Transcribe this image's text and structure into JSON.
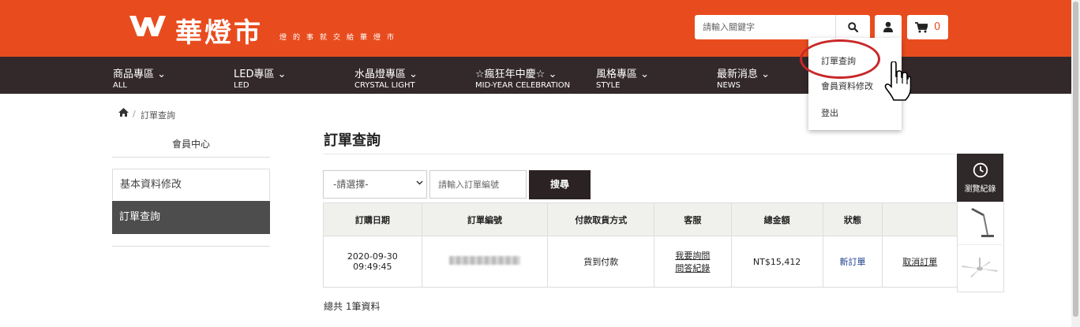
{
  "header": {
    "brand_name": "華燈市",
    "tagline": "燈的事就交給華燈市",
    "search": {
      "placeholder": "請輸入關鍵字"
    },
    "cart_count": "0",
    "colors": {
      "primary": "#e84c1e",
      "nav_bg": "#33292a"
    }
  },
  "nav": {
    "items": [
      {
        "label": "商品專區",
        "sub": "ALL"
      },
      {
        "label": "LED專區",
        "sub": "LED"
      },
      {
        "label": "水晶燈專區",
        "sub": "CRYSTAL LIGHT"
      },
      {
        "label": "☆瘋狂年中慶☆",
        "sub": "MID-YEAR CELEBRATION"
      },
      {
        "label": "風格專區",
        "sub": "STYLE"
      },
      {
        "label": "最新消息",
        "sub": "NEWS"
      }
    ]
  },
  "user_menu": {
    "items": [
      "訂單查詢",
      "會員資料修改",
      "登出"
    ]
  },
  "breadcrumb": {
    "current": "訂單查詢"
  },
  "sidebar": {
    "title": "會員中心",
    "items": [
      "基本資料修改",
      "訂單查詢"
    ]
  },
  "main": {
    "title": "訂單查詢",
    "filter": {
      "select_value": "-請選擇-",
      "order_placeholder": "請輸入訂單編號",
      "search_label": "搜尋"
    },
    "table": {
      "headers": [
        "訂購日期",
        "訂單編號",
        "付款取貨方式",
        "客服",
        "總金額",
        "狀態",
        ""
      ],
      "rows": [
        {
          "date": "2020-09-30",
          "time": "09:49:45",
          "payment": "貨到付款",
          "service_ask": "我要詢問",
          "service_history": "問答紀錄",
          "total": "NT$15,412",
          "status": "新訂單",
          "action": "取消訂單"
        }
      ]
    },
    "summary": "總共 1筆資料"
  },
  "browse_history": {
    "label": "瀏覽紀錄"
  }
}
